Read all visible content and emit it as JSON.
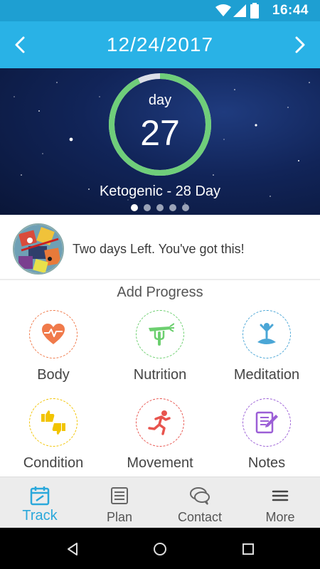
{
  "status_bar": {
    "time": "16:44"
  },
  "header": {
    "date": "12/24/2017"
  },
  "hero": {
    "day_label": "day",
    "day_number": "27",
    "program": "Ketogenic - 28 Day",
    "ring_progress": 0.9286,
    "ring_color": "#6fce7a",
    "carousel_pages": 5,
    "carousel_active": 0
  },
  "message": {
    "text": "Two days Left. You've got this!"
  },
  "progress": {
    "title": "Add Progress",
    "items": [
      {
        "label": "Body",
        "icon": "heart-pulse-icon",
        "color": "#f07a4b"
      },
      {
        "label": "Nutrition",
        "icon": "carrot-fork-icon",
        "color": "#6ccf6f"
      },
      {
        "label": "Meditation",
        "icon": "meditation-pose-icon",
        "color": "#4aa6d6"
      },
      {
        "label": "Condition",
        "icon": "thumbs-up-down-icon",
        "color": "#f2c400"
      },
      {
        "label": "Movement",
        "icon": "running-person-icon",
        "color": "#e8544e"
      },
      {
        "label": "Notes",
        "icon": "notepad-pencil-icon",
        "color": "#9b5ed6"
      }
    ]
  },
  "tabs": [
    {
      "label": "Track",
      "icon": "calendar-icon",
      "active": true
    },
    {
      "label": "Plan",
      "icon": "list-icon",
      "active": false
    },
    {
      "label": "Contact",
      "icon": "chat-bubbles-icon",
      "active": false
    },
    {
      "label": "More",
      "icon": "menu-icon",
      "active": false
    }
  ],
  "colors": {
    "header": "#29b2e6",
    "status_bar": "#1e9fd2",
    "accent": "#2aa8db"
  }
}
